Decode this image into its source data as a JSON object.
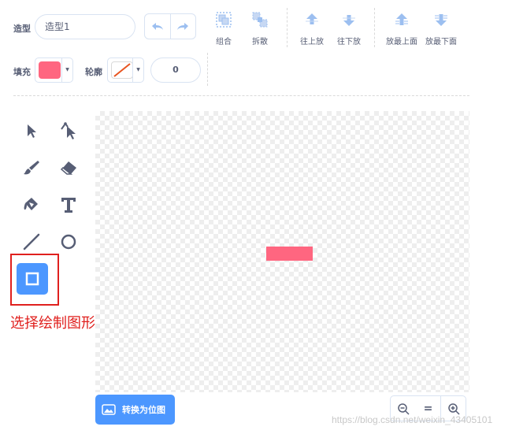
{
  "toolbar": {
    "costume_label": "造型",
    "costume_name": "造型1",
    "group_label": "组合",
    "ungroup_label": "拆散",
    "forward_label": "往上放",
    "backward_label": "往下放",
    "front_label": "放最上面",
    "back_label": "放最下面"
  },
  "style_row": {
    "fill_label": "填充",
    "fill_color": "#ff6680",
    "outline_label": "轮廓",
    "outline_size": "0"
  },
  "tools": {
    "selected": "rectangle-tool"
  },
  "canvas": {
    "shape_color": "#ff6680"
  },
  "annotation": {
    "text": "选择绘制图形",
    "color": "#e0201e"
  },
  "bottom": {
    "convert_label": "转换为位图",
    "zoom_reset_label": "="
  },
  "watermark": "https://blog.csdn.net/weixin_43405101",
  "colors": {
    "accent": "#4c97ff",
    "text": "#575e75",
    "icon": "#855cd6"
  }
}
